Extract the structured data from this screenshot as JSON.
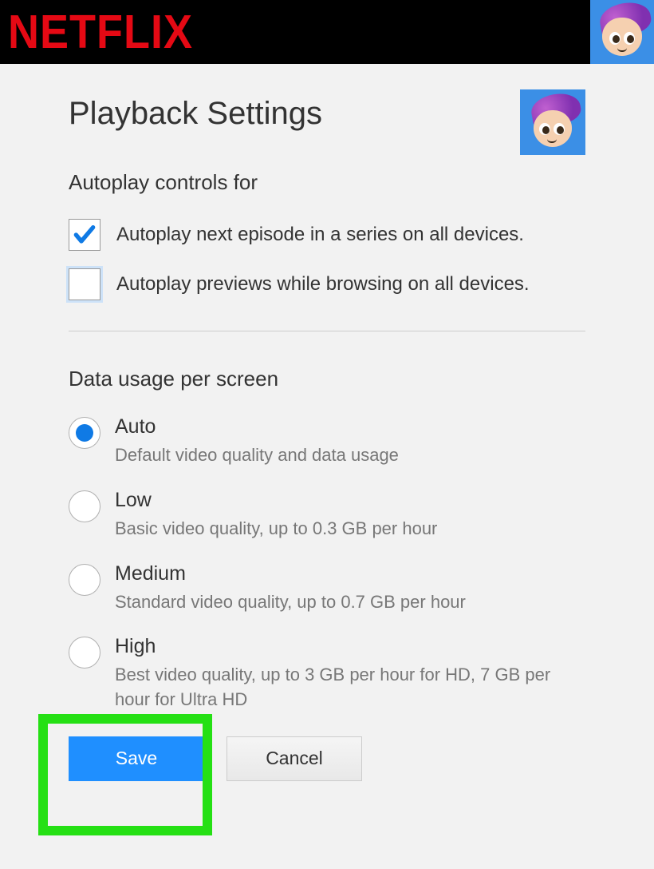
{
  "brand": "NETFLIX",
  "page": {
    "title": "Playback Settings",
    "autoplay_section_title": "Autoplay controls for",
    "autoplay_options": [
      {
        "label": "Autoplay next episode in a series on all devices.",
        "checked": true
      },
      {
        "label": "Autoplay previews while browsing on all devices.",
        "checked": false
      }
    ],
    "data_usage_title": "Data usage per screen",
    "data_usage_options": [
      {
        "label": "Auto",
        "desc": "Default video quality and data usage",
        "selected": true
      },
      {
        "label": "Low",
        "desc": "Basic video quality, up to 0.3 GB per hour",
        "selected": false
      },
      {
        "label": "Medium",
        "desc": "Standard video quality, up to 0.7 GB per hour",
        "selected": false
      },
      {
        "label": "High",
        "desc": "Best video quality, up to 3 GB per hour for HD, 7 GB per hour for Ultra HD",
        "selected": false
      }
    ],
    "buttons": {
      "save": "Save",
      "cancel": "Cancel"
    }
  }
}
